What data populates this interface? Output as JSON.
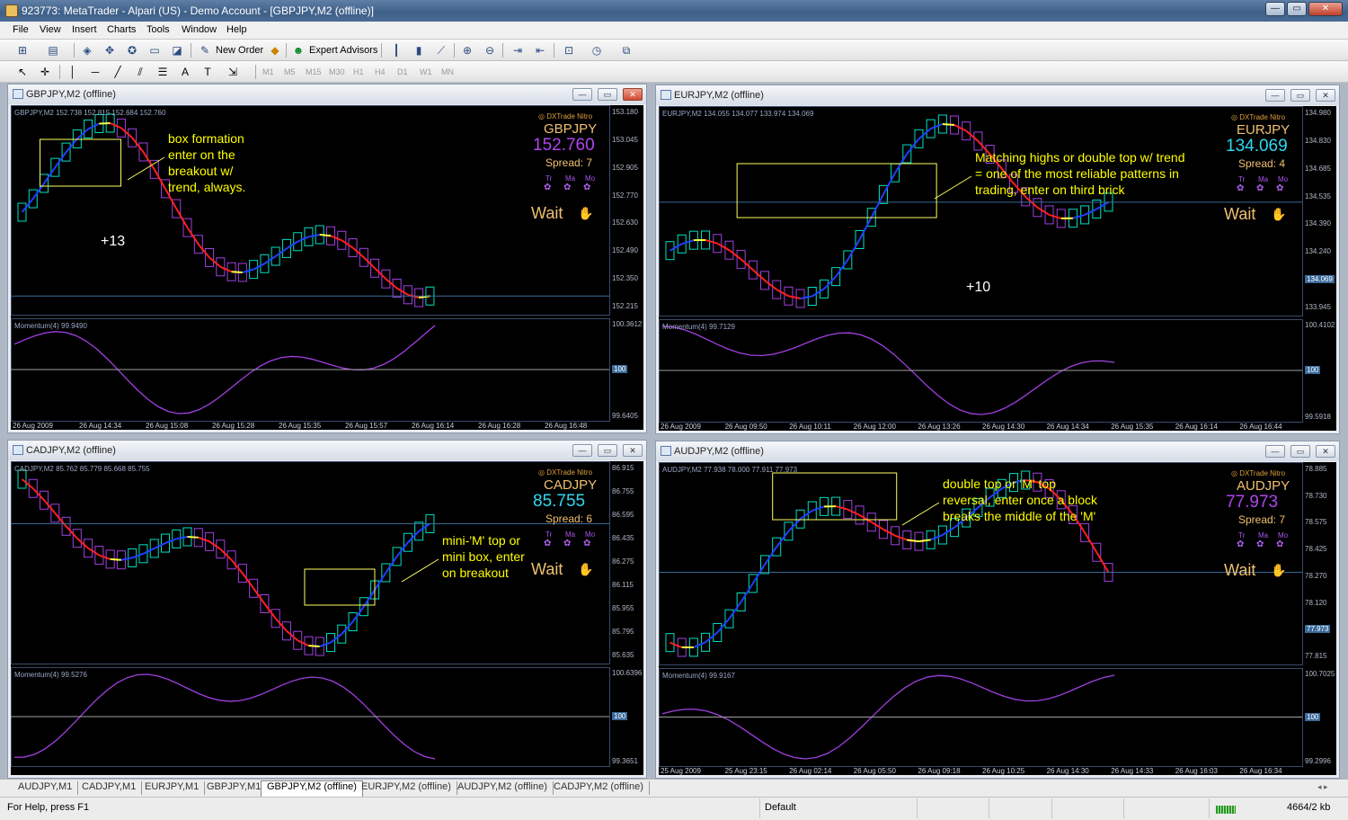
{
  "app": {
    "title": "923773: MetaTrader - Alpari (US) - Demo Account - [GBPJPY,M2 (offline)]",
    "btn_min": "—",
    "btn_max": "▭",
    "btn_close": "✕"
  },
  "menu": [
    "File",
    "View",
    "Insert",
    "Charts",
    "Tools",
    "Window",
    "Help"
  ],
  "toolbar": {
    "new_order": "New Order",
    "expert_advisors": "Expert Advisors",
    "timeframes": [
      "M1",
      "M5",
      "M15",
      "M30",
      "H1",
      "H4",
      "D1",
      "W1",
      "MN"
    ]
  },
  "colors": {
    "bull": "#00e0c0",
    "bear": "#a040e0",
    "ma_down": "#ff2020",
    "ma_up": "#2040ff",
    "ma_flat": "#ffff40",
    "momentum": "#a040e0",
    "annotation": "#ffff00"
  },
  "icons": [
    "new-chart-icon",
    "profiles-icon",
    "crosshair-icon",
    "zoom-in-icon",
    "zoom-out-icon",
    "cursor-icon",
    "hline-icon",
    "trendline-icon",
    "text-icon",
    "hand-icon"
  ],
  "charts": [
    {
      "window_title": "GBPJPY,M2 (offline)",
      "info": "GBPJPY,M2  152.738 152.815 152.684 152.760",
      "symbol": "GBPJPY",
      "price": "152.760",
      "price_color": "#b044f0",
      "spread": "Spread: 7",
      "dx": "◎ DXTrade Nitro",
      "tma": [
        "Tr",
        "Ma",
        "Mo"
      ],
      "wait": "Wait",
      "y_labels": [
        "153.180",
        "153.045",
        "152.905",
        "152.770",
        "152.630",
        "152.490",
        "152.350",
        "152.215"
      ],
      "price_box": "152.760",
      "momentum_label": "Momentum(4) 99.9490",
      "mom_labels": [
        "100.3612",
        "100",
        "99.6405"
      ],
      "x_labels": [
        "26 Aug 2009",
        "26 Aug 14:34",
        "26 Aug 15:08",
        "26 Aug 15:28",
        "26 Aug 15:35",
        "26 Aug 15:57",
        "26 Aug 16:14",
        "26 Aug 16:28",
        "26 Aug 16:48"
      ],
      "annotation": [
        "box formation",
        "enter on the",
        "breakout w/",
        "trend, always."
      ],
      "pips": "+13"
    },
    {
      "window_title": "EURJPY,M2 (offline)",
      "info": "EURJPY,M2  134.055 134.077 133.974 134.069",
      "symbol": "EURJPY",
      "price": "134.069",
      "price_color": "#30d8f0",
      "spread": "Spread: 4",
      "dx": "◎ DXTrade Nitro",
      "tma": [
        "Tr",
        "Ma",
        "Mo"
      ],
      "wait": "Wait",
      "y_labels": [
        "134.980",
        "134.830",
        "134.685",
        "134.535",
        "134.390",
        "134.240",
        "134.069",
        "133.945"
      ],
      "price_box": "134.069",
      "momentum_label": "Momentum(4) 99.7129",
      "mom_labels": [
        "100.4102",
        "100",
        "99.5918"
      ],
      "x_labels": [
        "26 Aug 2009",
        "26 Aug 09:50",
        "26 Aug 10:11",
        "26 Aug 12:00",
        "26 Aug 13:26",
        "26 Aug 14:30",
        "26 Aug 14:34",
        "26 Aug 15:35",
        "26 Aug 16:14",
        "26 Aug 16:44"
      ],
      "annotation": [
        "Matching highs or double top w/ trend",
        "= one of the most reliable patterns in",
        "trading, enter on third brick"
      ],
      "pips": "+10"
    },
    {
      "window_title": "CADJPY,M2 (offline)",
      "info": "CADJPY,M2  85.762 85.779 85.668 85.755",
      "symbol": "CADJPY",
      "price": "85.755",
      "price_color": "#30d8f0",
      "spread": "Spread: 6",
      "dx": "◎ DXTrade Nitro",
      "tma": [
        "Tr",
        "Ma",
        "Mo"
      ],
      "wait": "Wait",
      "y_labels": [
        "86.915",
        "86.755",
        "86.595",
        "86.435",
        "86.275",
        "86.115",
        "85.955",
        "85.795",
        "85.635"
      ],
      "price_box": "85.755",
      "momentum_label": "Momentum(4) 99.5276",
      "mom_labels": [
        "100.6396",
        "100",
        "99.3651"
      ],
      "x_labels": [],
      "annotation": [
        "mini-'M' top or",
        "mini box, enter",
        "on breakout"
      ],
      "pips": ""
    },
    {
      "window_title": "AUDJPY,M2 (offline)",
      "info": "AUDJPY,M2  77.938 78.000 77.911 77.973",
      "symbol": "AUDJPY",
      "price": "77.973",
      "price_color": "#b044f0",
      "spread": "Spread: 7",
      "dx": "◎ DXTrade Nitro",
      "tma": [
        "Tr",
        "Ma",
        "Mo"
      ],
      "wait": "Wait",
      "y_labels": [
        "78.885",
        "78.730",
        "78.575",
        "78.425",
        "78.270",
        "78.120",
        "77.973",
        "77.815"
      ],
      "price_box": "77.973",
      "momentum_label": "Momentum(4) 99.9167",
      "mom_labels": [
        "100.7025",
        "100",
        "99.2996"
      ],
      "x_labels": [
        "25 Aug 2009",
        "25 Aug 23:15",
        "26 Aug 02:14",
        "26 Aug 05:50",
        "26 Aug 09:18",
        "26 Aug 10:25",
        "26 Aug 14:30",
        "26 Aug 14:33",
        "26 Aug 16:03",
        "26 Aug 16:34"
      ],
      "annotation": [
        "double top or 'M' top",
        "reversal, enter once a block",
        "breaks the middle of the 'M'"
      ],
      "pips": ""
    }
  ],
  "tabs": [
    "AUDJPY,M1",
    "CADJPY,M1",
    "EURJPY,M1",
    "GBPJPY,M1",
    "GBPJPY,M2 (offline)",
    "EURJPY,M2 (offline)",
    "AUDJPY,M2 (offline)",
    "CADJPY,M2 (offline)"
  ],
  "active_tab": 4,
  "status": {
    "help": "For Help, press F1",
    "profile": "Default",
    "traffic": "4664/2 kb"
  }
}
